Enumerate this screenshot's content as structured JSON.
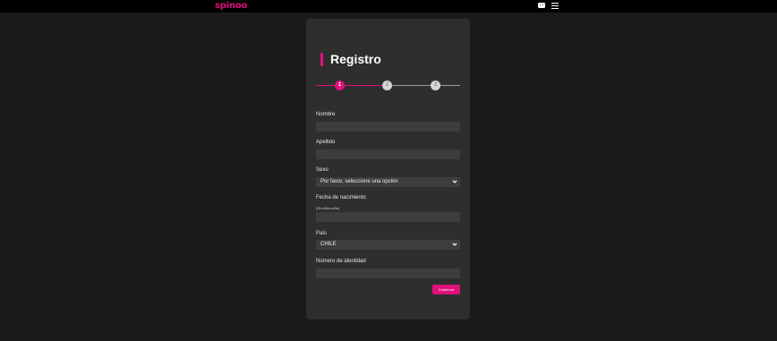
{
  "header": {
    "logo_text": "spinoo",
    "brand_color": "#e0107d",
    "icons": [
      "chat-icon",
      "menu-icon"
    ]
  },
  "form": {
    "title": "Registro",
    "steps": [
      {
        "label": "1",
        "state": "active"
      },
      {
        "label": "2",
        "state": "inactive"
      },
      {
        "label": "3",
        "state": "inactive"
      }
    ],
    "fields": {
      "nombre": {
        "label": "Nombre",
        "value": ""
      },
      "apellido": {
        "label": "Apellido",
        "value": ""
      },
      "sexo": {
        "label": "Sexo",
        "selected": "Por favor, seleccione una opción"
      },
      "fecha": {
        "label": "Fecha de nacimiento",
        "hint": "(Día-Mes-Año)",
        "value": ""
      },
      "pais": {
        "label": "País",
        "selected": "CHILE"
      },
      "identidad": {
        "label": "Número de identidad",
        "value": ""
      }
    },
    "submit_label": "Continuar"
  }
}
